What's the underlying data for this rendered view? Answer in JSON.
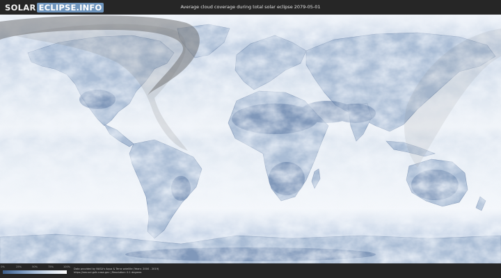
{
  "header": {
    "logo_part1": "SOLAR",
    "logo_part2": "ECLIPSE.INFO",
    "title": "Average cloud coverage during total solar eclipse 2079-05-01"
  },
  "legend": {
    "ticks": [
      "0%",
      "25%",
      "50%",
      "75%",
      "100%"
    ],
    "colors": [
      "#3e5f8a",
      "#6f8fb8",
      "#a8bfdb",
      "#dbe6f2",
      "#ffffff"
    ]
  },
  "footer": {
    "credit_line1": "Data provided by NASA's Aqua & Terra satellite (Years: 2000 - 2019)",
    "credit_line2": "https://neo.sci.gsfc.nasa.gov | Resolution: 0.1 degrees"
  },
  "map": {
    "ocean_color": "#e6edf6",
    "land_color": "#9cb1cc",
    "cloudy_color": "#f4f7fb",
    "clear_color": "#5d78a0",
    "eclipse_shadow_color": "#5a5a5a"
  }
}
